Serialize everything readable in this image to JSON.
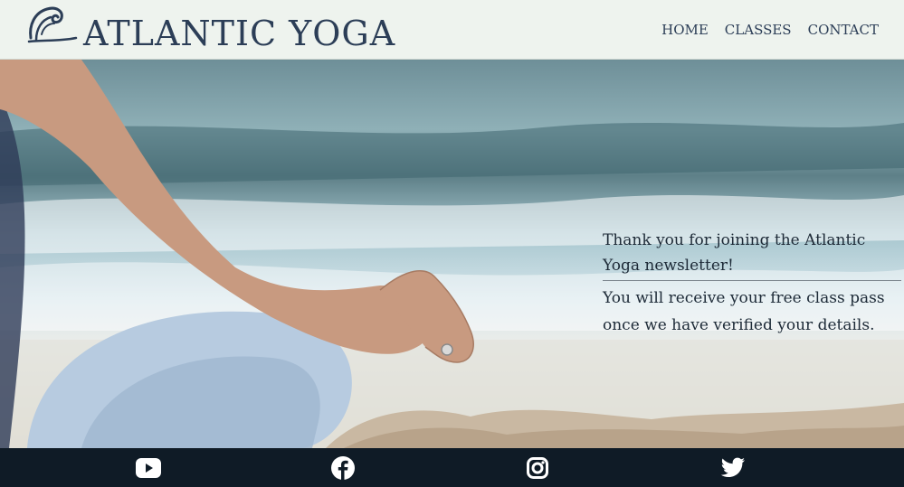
{
  "header": {
    "brand": "ATLANTIC YOGA",
    "logo_icon": "wave-icon",
    "nav": [
      {
        "label": "HOME"
      },
      {
        "label": "CLASSES"
      },
      {
        "label": "CONTACT"
      }
    ]
  },
  "hero": {
    "message_line1": "Thank you for joining the Atlantic Yoga newsletter!",
    "message_line2": "You will receive your free class pass once we have verified your details."
  },
  "footer": {
    "social": [
      {
        "icon": "youtube-icon"
      },
      {
        "icon": "facebook-icon"
      },
      {
        "icon": "instagram-icon"
      },
      {
        "icon": "twitter-icon"
      }
    ]
  },
  "colors": {
    "header_bg": "#eef3ee",
    "brand_text": "#2c3e57",
    "footer_bg": "#0f1b26",
    "icon": "#ffffff"
  }
}
